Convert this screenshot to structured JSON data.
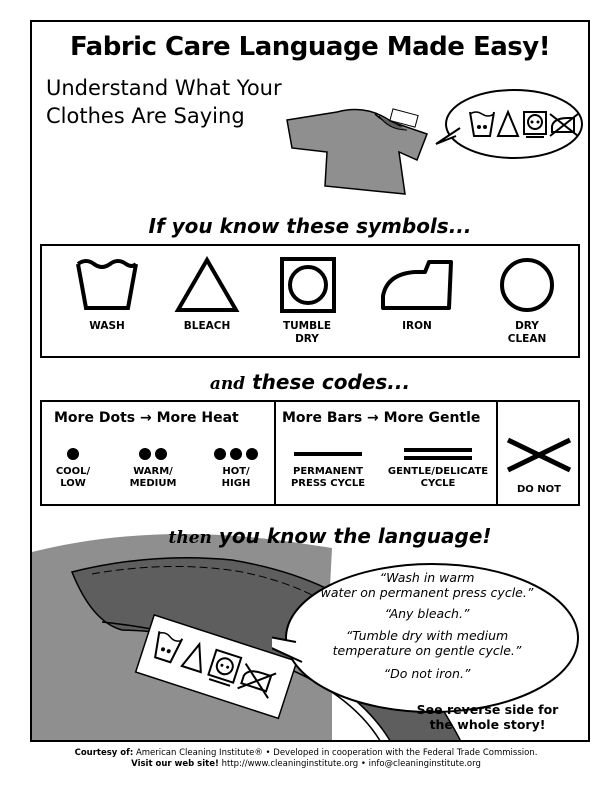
{
  "title": "Fabric Care Language Made Easy!",
  "subtitle": {
    "line1": "Understand What Your",
    "line2": "Clothes Are Saying"
  },
  "heading1": "If you know these symbols...",
  "symbols": [
    {
      "icon": "wash-icon",
      "label": "WASH"
    },
    {
      "icon": "bleach-icon",
      "label": "BLEACH"
    },
    {
      "icon": "tumble-dry-icon",
      "label_line1": "TUMBLE",
      "label_line2": "DRY"
    },
    {
      "icon": "iron-icon",
      "label": "IRON"
    },
    {
      "icon": "dry-clean-icon",
      "label_line1": "DRY",
      "label_line2": "CLEAN"
    }
  ],
  "heading2_prefix": "and",
  "heading2": "these codes...",
  "codes": {
    "dots_header": "More Dots → More Heat",
    "bars_header": "More Bars → More Gentle",
    "dots": [
      {
        "count": 1,
        "line1": "COOL/",
        "line2": "LOW"
      },
      {
        "count": 2,
        "line1": "WARM/",
        "line2": "MEDIUM"
      },
      {
        "count": 3,
        "line1": "HOT/",
        "line2": "HIGH"
      }
    ],
    "bars": [
      {
        "count": 1,
        "line1": "PERMANENT",
        "line2": "PRESS CYCLE"
      },
      {
        "count": 2,
        "line1": "GENTLE/DELICATE",
        "line2": "CYCLE"
      }
    ],
    "do_not": "DO NOT"
  },
  "heading3_prefix": "then",
  "heading3": "you know the language!",
  "quotes": [
    {
      "line1": "“Wash in warm",
      "line2": "water on permanent press cycle.”"
    },
    {
      "line1": "“Any bleach.”"
    },
    {
      "line1": "“Tumble dry with medium",
      "line2": "temperature on gentle cycle.”"
    },
    {
      "line1": "“Do not iron.”"
    }
  ],
  "see_reverse": {
    "line1": "See reverse side for",
    "line2": "the whole story!"
  },
  "footer": {
    "courtesy_label": "Courtesy of:",
    "courtesy_text": "American Cleaning Institute® • Developed in cooperation with the Federal Trade Commission.",
    "visit_label": "Visit our web site!",
    "visit_text": "http://www.cleaninginstitute.org  •  info@cleaninginstitute.org"
  },
  "colors": {
    "shirt": "#8f8f8f",
    "shirt_dark": "#5e5e5e",
    "line": "#000000"
  }
}
